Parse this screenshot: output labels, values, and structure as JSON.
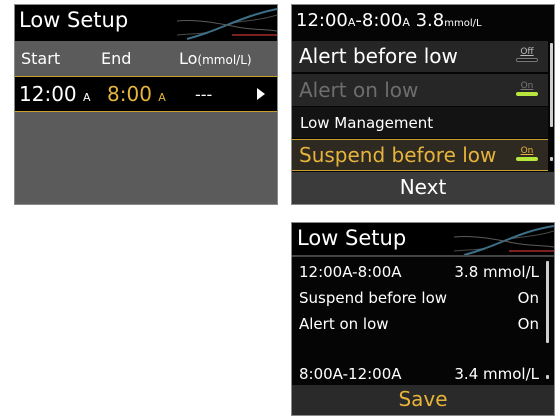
{
  "colors": {
    "accent_gold": "#e6b43a",
    "toggle_on": "#b7e63c",
    "background_black": "#050505",
    "panel_gray": "#5b5b5b"
  },
  "screen1": {
    "title": "Low Setup",
    "columns": {
      "start": "Start",
      "end": "End",
      "lo": "Lo",
      "lo_unit": "(mmol/L)"
    },
    "row": {
      "start_time": "12:00",
      "start_suffix": "A",
      "end_time": "8:00",
      "end_suffix": "A",
      "lo_value": "---"
    }
  },
  "screen2": {
    "header_time": "12:00",
    "header_suffix1": "A",
    "header_dash": "-8:00",
    "header_suffix2": "A",
    "header_value": "3.8",
    "header_unit": "mmol/L",
    "items": [
      {
        "label": "Alert before low",
        "toggle": "Off",
        "enabled": true
      },
      {
        "label": "Alert on low",
        "toggle": "On",
        "enabled": false
      }
    ],
    "section": "Low Management",
    "selected_item": {
      "label": "Suspend before low",
      "toggle": "On"
    },
    "next_label": "Next"
  },
  "screen3": {
    "title": "Low Setup",
    "lines": [
      {
        "left": "12:00A-8:00A",
        "right": "3.8 mmol/L"
      },
      {
        "left": "Suspend before low",
        "right": "On"
      },
      {
        "left": "Alert on low",
        "right": "On"
      },
      {
        "left": "8:00A-12:00A",
        "right": "3.4 mmol/L"
      }
    ],
    "save_label": "Save"
  }
}
